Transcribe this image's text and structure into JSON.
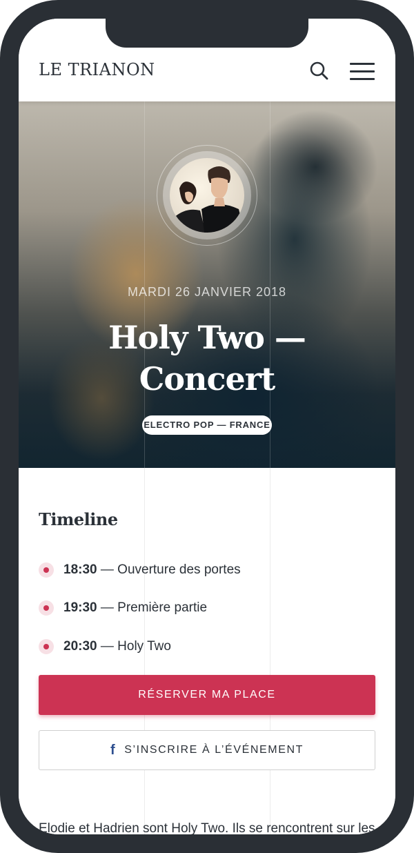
{
  "header": {
    "logo": "LE TRIANON",
    "search_icon": "search-icon",
    "menu_icon": "hamburger-menu-icon"
  },
  "event": {
    "date": "MARDI 26 JANVIER 2018",
    "title_line1": "Holy Two —",
    "title_line2": "Concert",
    "genre": "ELECTRO POP — FRANCE"
  },
  "timeline": {
    "title": "Timeline",
    "items": [
      {
        "time": "18:30",
        "label": " — Ouverture des portes"
      },
      {
        "time": "19:30",
        "label": " — Première partie"
      },
      {
        "time": "20:30",
        "label": " — Holy Two"
      }
    ]
  },
  "actions": {
    "reserve_label": "RÉSERVER MA PLACE",
    "facebook_label": "S’INSCRIRE À L’ÉVÉNEMENT",
    "facebook_icon": "facebook-icon"
  },
  "description": "Elodie et Hadrien sont Holy Two. Ils se rencontrent sur les bancs de l’école d’architecture de Lyon. Rien",
  "colors": {
    "accent": "#cc3353",
    "text": "#2b3138",
    "frame": "#2a2f35",
    "facebook": "#2e4f8f"
  }
}
